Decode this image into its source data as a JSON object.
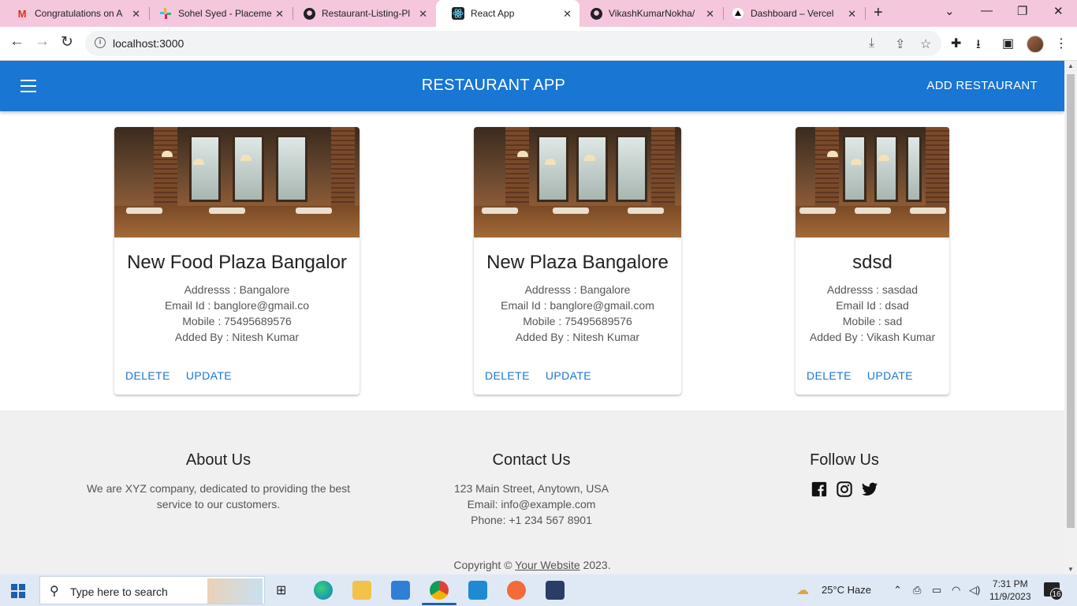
{
  "browser": {
    "tabs": [
      {
        "title": "Congratulations on A",
        "icon": "gmail-icon"
      },
      {
        "title": "Sohel Syed - Placeme",
        "icon": "slack-icon"
      },
      {
        "title": "Restaurant-Listing-Pl",
        "icon": "github-icon"
      },
      {
        "title": "React App",
        "icon": "react-icon",
        "active": true
      },
      {
        "title": "VikashKumarNokha/",
        "icon": "github-icon"
      },
      {
        "title": "Dashboard – Vercel",
        "icon": "vercel-icon"
      }
    ],
    "url": "localhost:3000"
  },
  "app": {
    "title": "RESTAURANT APP",
    "add_button": "ADD RESTAURANT",
    "accent": "#1976d2",
    "restaurants": [
      {
        "name": "New Food Plaza Bangalor",
        "address": "Addresss : Bangalore",
        "email": "Email Id : banglore@gmail.co",
        "mobile": "Mobile : 75495689576",
        "added_by": "Added By : Nitesh Kumar",
        "delete": "DELETE",
        "update": "UPDATE"
      },
      {
        "name": "New Plaza Bangalore",
        "address": "Addresss : Bangalore",
        "email": "Email Id : banglore@gmail.com",
        "mobile": "Mobile : 75495689576",
        "added_by": "Added By : Nitesh Kumar",
        "delete": "DELETE",
        "update": "UPDATE"
      },
      {
        "name": "sdsd",
        "address": "Addresss : sasdad",
        "email": "Email Id : dsad",
        "mobile": "Mobile : sad",
        "added_by": "Added By : Vikash Kumar",
        "delete": "DELETE",
        "update": "UPDATE"
      }
    ]
  },
  "footer": {
    "about": {
      "title": "About Us",
      "line1": "We are XYZ company, dedicated to providing the best",
      "line2": "service to our customers."
    },
    "contact": {
      "title": "Contact Us",
      "address": "123 Main Street, Anytown, USA",
      "email": "Email: info@example.com",
      "phone": "Phone: +1 234 567 8901"
    },
    "follow": {
      "title": "Follow Us",
      "icons": [
        "facebook-icon",
        "instagram-icon",
        "twitter-icon"
      ]
    },
    "copyright_prefix": "Copyright ©",
    "copyright_link": "Your Website",
    "copyright_suffix": "2023."
  },
  "taskbar": {
    "search_placeholder": "Type here to search",
    "weather": "25°C  Haze",
    "time": "7:31 PM",
    "date": "11/9/2023",
    "notifications": "16"
  }
}
